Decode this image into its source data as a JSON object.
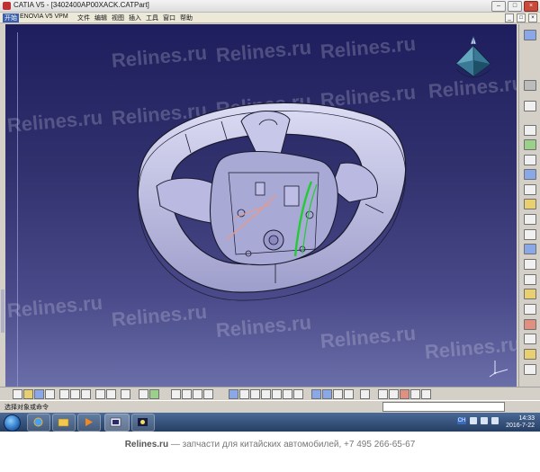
{
  "window": {
    "title": "CATIA V5 - [3402400AP00XACK.CATPart]",
    "controls": {
      "minimize": "–",
      "maximize": "□",
      "close": "×"
    }
  },
  "menubar": {
    "items": [
      "开始",
      "ENOVIA V5 VPM",
      "文件",
      "编辑",
      "视图",
      "插入",
      "工具",
      "窗口",
      "帮助"
    ],
    "inner_controls": [
      "_",
      "□",
      "×"
    ]
  },
  "viewport": {
    "watermark_text": "Relines.ru",
    "compass_icon": "compass-icon",
    "axis_icon": "axis-triad-icon",
    "colors": {
      "background_top": "#1e1e5e",
      "background_bottom": "#6a6ea8",
      "model": "#bdbde6",
      "edges": "#1a1a2e",
      "accent_green": "#22cc33",
      "accent_salmon": "#e89a88"
    }
  },
  "status": {
    "message": "选择对象或命令",
    "command_placeholder": ""
  },
  "taskbar": {
    "start_icon": "windows-start-orb-icon",
    "apps": [
      "internet-explorer-icon",
      "file-explorer-icon",
      "media-player-icon",
      "catia-app-icon",
      "image-viewer-icon"
    ],
    "tray": {
      "language": "CH",
      "time": "14:33",
      "date": "2016-7-22"
    }
  },
  "footer": {
    "site": "Relines.ru",
    "tagline": " — запчасти для китайских автомобилей, +7 495 266-65-67"
  }
}
